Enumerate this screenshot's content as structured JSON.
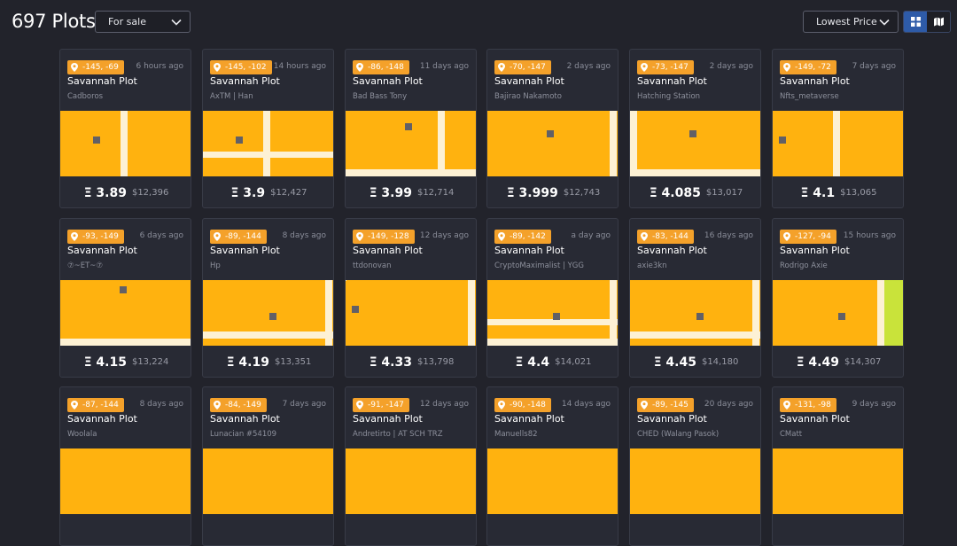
{
  "header": {
    "count_label": "697 Plots",
    "filter_value": "For sale",
    "sort_value": "Lowest Price"
  },
  "views": [
    "grid-icon",
    "map-icon"
  ],
  "colors": {
    "badge": "#f4a12a",
    "map_land": "#ffb20f",
    "road": "#fdf1d4",
    "active_view": "#2e5ba8"
  },
  "plots": [
    {
      "coords": "-145, -69",
      "time": "6 hours ago",
      "title": "Savannah Plot",
      "owner": "Cadboros",
      "eth": "Ξ 3.89",
      "usd": "$12,396"
    },
    {
      "coords": "-145, -102",
      "time": "14 hours ago",
      "title": "Savannah Plot",
      "owner": "AxTM | Han",
      "eth": "Ξ 3.9",
      "usd": "$12,427"
    },
    {
      "coords": "-86, -148",
      "time": "11 days ago",
      "title": "Savannah Plot",
      "owner": "Bad Bass Tony",
      "eth": "Ξ 3.99",
      "usd": "$12,714"
    },
    {
      "coords": "-70, -147",
      "time": "2 days ago",
      "title": "Savannah Plot",
      "owner": "Bajirao Nakamoto",
      "eth": "Ξ 3.999",
      "usd": "$12,743"
    },
    {
      "coords": "-73, -147",
      "time": "2 days ago",
      "title": "Savannah Plot",
      "owner": "Hatching Station",
      "eth": "Ξ 4.085",
      "usd": "$13,017"
    },
    {
      "coords": "-149, -72",
      "time": "7 days ago",
      "title": "Savannah Plot",
      "owner": "Nfts_metaverse",
      "eth": "Ξ 4.1",
      "usd": "$13,065"
    },
    {
      "coords": "-93, -149",
      "time": "6 days ago",
      "title": "Savannah Plot",
      "owner": "⑦~ET~⑦",
      "eth": "Ξ 4.15",
      "usd": "$13,224"
    },
    {
      "coords": "-89, -144",
      "time": "8 days ago",
      "title": "Savannah Plot",
      "owner": "Hp",
      "eth": "Ξ 4.19",
      "usd": "$13,351"
    },
    {
      "coords": "-149, -128",
      "time": "12 days ago",
      "title": "Savannah Plot",
      "owner": "ttdonovan",
      "eth": "Ξ 4.33",
      "usd": "$13,798"
    },
    {
      "coords": "-89, -142",
      "time": "a day ago",
      "title": "Savannah Plot",
      "owner": "CryptoMaximalist | YGG",
      "eth": "Ξ 4.4",
      "usd": "$14,021"
    },
    {
      "coords": "-83, -144",
      "time": "16 days ago",
      "title": "Savannah Plot",
      "owner": "axie3kn",
      "eth": "Ξ 4.45",
      "usd": "$14,180"
    },
    {
      "coords": "-127, -94",
      "time": "15 hours ago",
      "title": "Savannah Plot",
      "owner": "Rodrigo Axie",
      "eth": "Ξ 4.49",
      "usd": "$14,307"
    },
    {
      "coords": "-87, -144",
      "time": "8 days ago",
      "title": "Savannah Plot",
      "owner": "Woolala",
      "eth": "",
      "usd": ""
    },
    {
      "coords": "-84, -149",
      "time": "7 days ago",
      "title": "Savannah Plot",
      "owner": "Lunacian #54109",
      "eth": "",
      "usd": ""
    },
    {
      "coords": "-91, -147",
      "time": "12 days ago",
      "title": "Savannah Plot",
      "owner": "Andretirto | AT SCH TRZ",
      "eth": "",
      "usd": ""
    },
    {
      "coords": "-90, -148",
      "time": "14 days ago",
      "title": "Savannah Plot",
      "owner": "Manuells82",
      "eth": "",
      "usd": ""
    },
    {
      "coords": "-89, -145",
      "time": "20 days ago",
      "title": "Savannah Plot",
      "owner": "CHED (Walang Pasok)",
      "eth": "",
      "usd": ""
    },
    {
      "coords": "-131, -98",
      "time": "9 days ago",
      "title": "Savannah Plot",
      "owner": "CMatt",
      "eth": "",
      "usd": ""
    }
  ]
}
